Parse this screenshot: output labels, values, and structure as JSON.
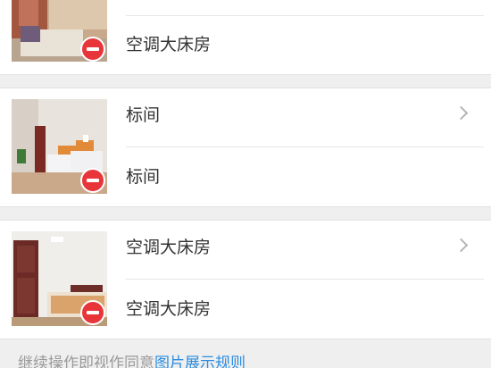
{
  "items": [
    {
      "type": "空调大床房"
    },
    {
      "title": "标间",
      "type": "标间"
    },
    {
      "title": "空调大床房",
      "type": "空调大床房"
    }
  ],
  "footer": {
    "text": "继续操作即视作同意",
    "link": "图片展示规则"
  },
  "colors": {
    "delete": "#e8353a",
    "link": "#2a8de0",
    "background": "#efefef"
  },
  "icons": {
    "delete": "minus-circle-icon",
    "chevron": "chevron-right-icon"
  }
}
